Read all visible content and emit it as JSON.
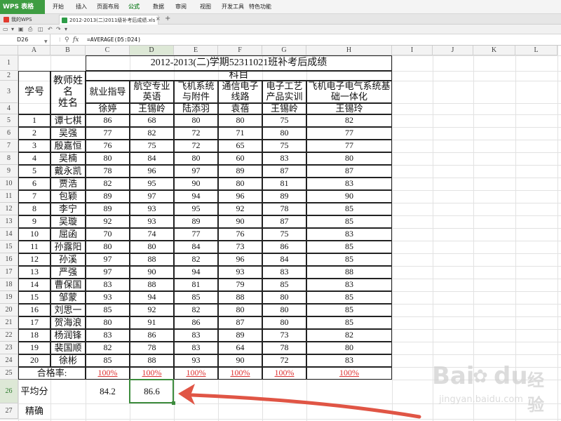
{
  "app": {
    "logo": "WPS 表格",
    "menu": [
      "开始",
      "插入",
      "页面布局",
      "公式",
      "数据",
      "审阅",
      "视图",
      "开发工具",
      "特色功能"
    ],
    "active_menu": "公式"
  },
  "tabs": [
    {
      "label": "我的WPS",
      "close": false
    },
    {
      "label": "2012-2013(二)2011级补考后成绩.xls *",
      "close": true
    }
  ],
  "new_tab": "+",
  "formula_bar": {
    "cell_ref": "D26",
    "fx": "fx",
    "formula": "=AVERAGE(D5:D24)"
  },
  "columns": [
    "A",
    "B",
    "C",
    "D",
    "E",
    "F",
    "G",
    "H",
    "I",
    "J",
    "K",
    "L"
  ],
  "rows": [
    "1",
    "2",
    "3",
    "4",
    "5",
    "6",
    "7",
    "8",
    "9",
    "10",
    "11",
    "12",
    "13",
    "14",
    "15",
    "16",
    "17",
    "18",
    "19",
    "20",
    "21",
    "22",
    "23",
    "24",
    "25",
    "26",
    "27"
  ],
  "selected": {
    "col": "D",
    "row": "26"
  },
  "table": {
    "title": "2012-2013(二)学期52311021班补考后成绩",
    "subject_group": "科目",
    "id_header": "学号",
    "teacher_header": "教师姓名\n姓名",
    "subjects": [
      "就业指导",
      "航空专业英语",
      "飞机系统与附件",
      "通信电子线路",
      "电子工艺产品实训",
      "飞机电子电气系统基础一体化"
    ],
    "teachers": [
      "徐婷",
      "王锡岭",
      "陆添羽",
      "袁蓓",
      "王锡岭",
      "王锡玲"
    ],
    "students": [
      {
        "id": "1",
        "name": "谭七棋",
        "scores": [
          86,
          68,
          80,
          80,
          75,
          82
        ]
      },
      {
        "id": "2",
        "name": "吴强",
        "scores": [
          77,
          82,
          72,
          71,
          80,
          77
        ]
      },
      {
        "id": "3",
        "name": "殷嘉恒",
        "scores": [
          76,
          75,
          72,
          65,
          75,
          77
        ]
      },
      {
        "id": "4",
        "name": "吴楠",
        "scores": [
          80,
          84,
          80,
          60,
          83,
          80
        ]
      },
      {
        "id": "5",
        "name": "戴永凯",
        "scores": [
          78,
          96,
          97,
          89,
          87,
          87
        ]
      },
      {
        "id": "6",
        "name": "贾浩",
        "scores": [
          82,
          95,
          90,
          80,
          81,
          83
        ]
      },
      {
        "id": "7",
        "name": "包颖",
        "scores": [
          89,
          97,
          94,
          96,
          89,
          90
        ]
      },
      {
        "id": "8",
        "name": "李宁",
        "scores": [
          89,
          93,
          95,
          92,
          78,
          85
        ]
      },
      {
        "id": "9",
        "name": "吴璇",
        "scores": [
          92,
          93,
          89,
          90,
          87,
          85
        ]
      },
      {
        "id": "10",
        "name": "屈函",
        "scores": [
          70,
          74,
          77,
          76,
          75,
          83
        ]
      },
      {
        "id": "11",
        "name": "孙露阳",
        "scores": [
          80,
          80,
          84,
          73,
          86,
          85
        ]
      },
      {
        "id": "12",
        "name": "孙溪",
        "scores": [
          97,
          88,
          82,
          96,
          84,
          85
        ]
      },
      {
        "id": "13",
        "name": "严强",
        "scores": [
          97,
          90,
          94,
          93,
          83,
          88
        ]
      },
      {
        "id": "14",
        "name": "曹保国",
        "scores": [
          83,
          88,
          81,
          79,
          85,
          83
        ]
      },
      {
        "id": "15",
        "name": "邹蒙",
        "scores": [
          93,
          94,
          85,
          88,
          80,
          85
        ]
      },
      {
        "id": "16",
        "name": "刘思一",
        "scores": [
          85,
          92,
          82,
          80,
          80,
          85
        ]
      },
      {
        "id": "17",
        "name": "贺海浪",
        "scores": [
          80,
          91,
          86,
          87,
          80,
          85
        ]
      },
      {
        "id": "18",
        "name": "杨润锋",
        "scores": [
          83,
          86,
          83,
          89,
          73,
          82
        ]
      },
      {
        "id": "19",
        "name": "裴国顺",
        "scores": [
          82,
          78,
          83,
          64,
          78,
          80
        ]
      },
      {
        "id": "20",
        "name": "徐彬",
        "scores": [
          85,
          88,
          93,
          90,
          72,
          83
        ]
      }
    ],
    "pass_label": "合格率:",
    "pass_rates": [
      "100%",
      "100%",
      "100%",
      "100%",
      "100%",
      "100%"
    ],
    "avg_label": "平均分",
    "avg_values": [
      "84.2",
      "86.6"
    ],
    "precision_label": "精确"
  },
  "watermark": {
    "brand": "Bai",
    "brand2": "du",
    "cn": "经验",
    "url": "jingyan.baidu.com"
  },
  "colors": {
    "accent_green": "#3d8c3d",
    "arrow_red": "#e05545",
    "percent_red": "#d33"
  }
}
